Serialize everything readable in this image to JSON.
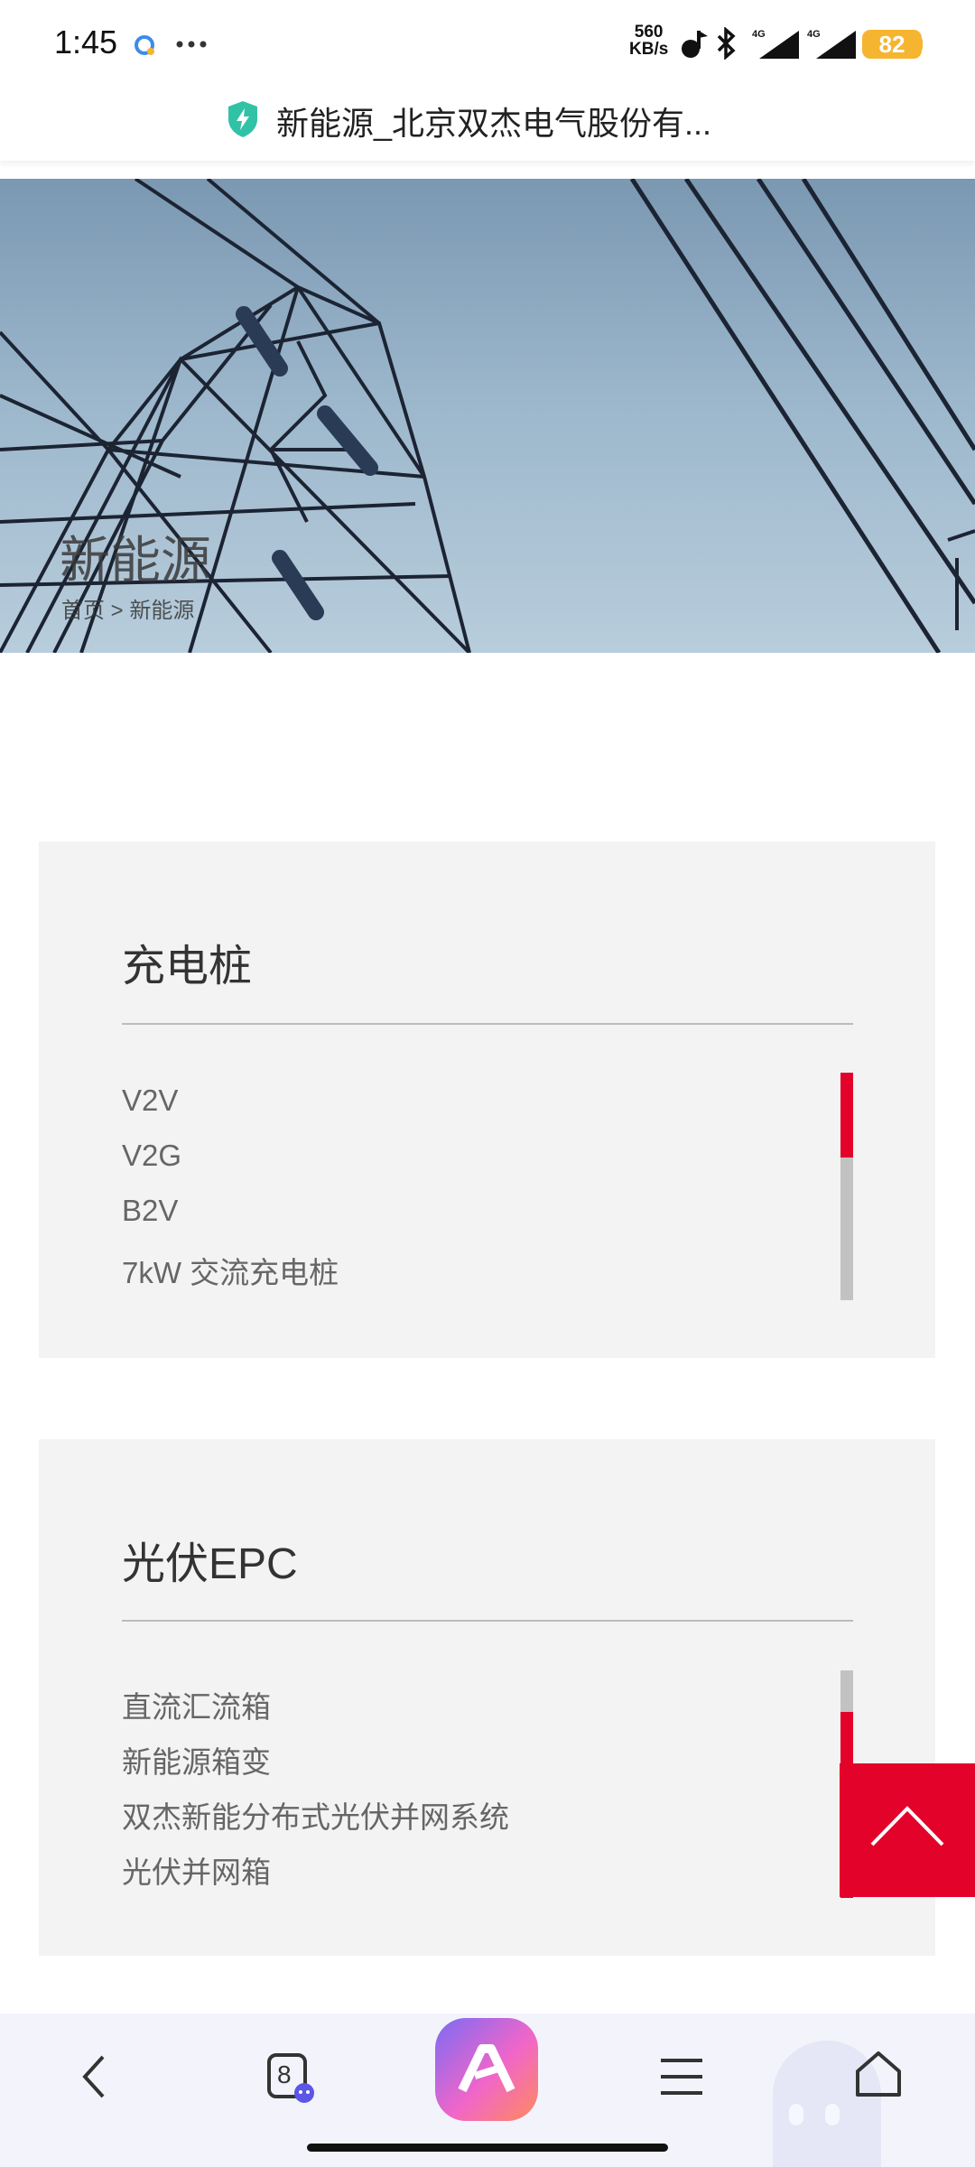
{
  "status_bar": {
    "time": "1:45",
    "net_speed_value": "560",
    "net_speed_unit": "KB/s",
    "network_1": "4G",
    "network_2": "4G",
    "battery": "82"
  },
  "title_bar": {
    "title": "新能源_北京双杰电气股份有..."
  },
  "banner": {
    "title": "新能源",
    "breadcrumb": "首页 > 新能源"
  },
  "cards": [
    {
      "title": "充电桩",
      "items": [
        "V2V",
        "V2G",
        "B2V",
        "7kW 交流充电桩"
      ]
    },
    {
      "title": "光伏EPC",
      "items": [
        "直流汇流箱",
        "新能源箱变",
        "双杰新能分布式光伏并网系统",
        "光伏并网箱"
      ]
    }
  ],
  "bottom_nav": {
    "tab_count": "8"
  },
  "colors": {
    "accent": "#e3032a",
    "card_bg": "#f3f3f3",
    "battery": "#f5b530"
  }
}
